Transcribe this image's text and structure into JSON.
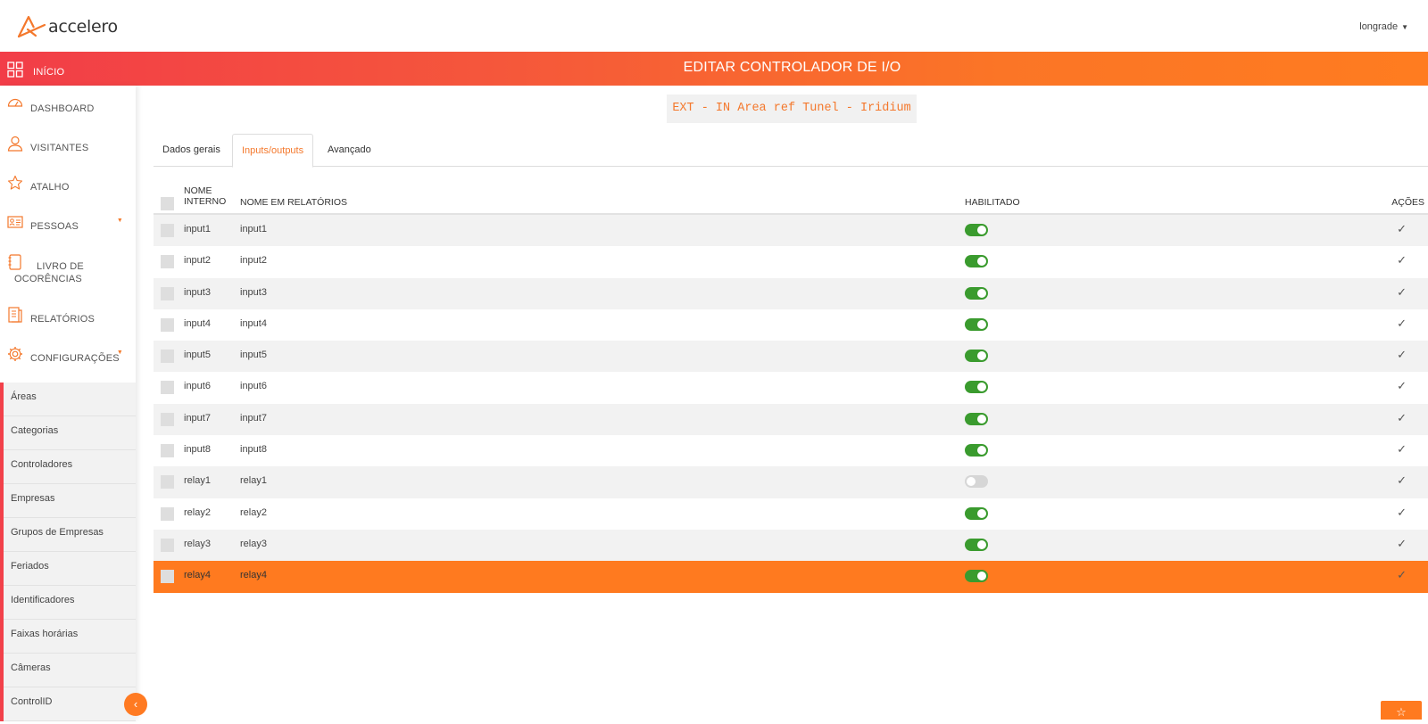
{
  "header": {
    "logo_text": "accelero",
    "user": "longrade"
  },
  "titlebar": {
    "home_label": "INÍCIO",
    "page_title": "EDITAR CONTROLADOR DE I/O"
  },
  "sidebar": {
    "items": [
      {
        "label": "DASHBOARD",
        "icon": "dashboard-gauge-icon"
      },
      {
        "label": "VISITANTES",
        "icon": "person-icon"
      },
      {
        "label": "ATALHO",
        "icon": "star-icon"
      },
      {
        "label": "PESSOAS",
        "icon": "id-card-icon"
      },
      {
        "label": "LIVRO DE OCORÊNCIAS",
        "icon": "book-icon"
      },
      {
        "label": "RELATÓRIOS",
        "icon": "report-icon"
      },
      {
        "label": "CONFIGURAÇÕES",
        "icon": "gear-icon"
      }
    ],
    "submenu": [
      "Áreas",
      "Categorias",
      "Controladores",
      "Empresas",
      "Grupos de Empresas",
      "Feriados",
      "Identificadores",
      "Faixas horárias",
      "Câmeras",
      "ControlID"
    ]
  },
  "controller_ref": "EXT - IN Area ref Tunel - Iridium",
  "tabs": [
    {
      "label": "Dados gerais",
      "active": false
    },
    {
      "label": "Inputs/outputs",
      "active": true
    },
    {
      "label": "Avançado",
      "active": false
    }
  ],
  "table": {
    "headers": {
      "internal_line1": "NOME",
      "internal_line2": "INTERNO",
      "report_name": "NOME EM RELATÓRIOS",
      "enabled": "HABILITADO",
      "actions": "AÇÕES"
    },
    "rows": [
      {
        "internal": "input1",
        "report": "input1",
        "enabled": true
      },
      {
        "internal": "input2",
        "report": "input2",
        "enabled": true
      },
      {
        "internal": "input3",
        "report": "input3",
        "enabled": true
      },
      {
        "internal": "input4",
        "report": "input4",
        "enabled": true
      },
      {
        "internal": "input5",
        "report": "input5",
        "enabled": true
      },
      {
        "internal": "input6",
        "report": "input6",
        "enabled": true
      },
      {
        "internal": "input7",
        "report": "input7",
        "enabled": true
      },
      {
        "internal": "input8",
        "report": "input8",
        "enabled": true
      },
      {
        "internal": "relay1",
        "report": "relay1",
        "enabled": false
      },
      {
        "internal": "relay2",
        "report": "relay2",
        "enabled": true
      },
      {
        "internal": "relay3",
        "report": "relay3",
        "enabled": true
      },
      {
        "internal": "relay4",
        "report": "relay4",
        "enabled": true,
        "selected": true
      }
    ],
    "action_glyph": "✓"
  },
  "colors": {
    "accent": "#ff7a1f",
    "gradient_start": "#f23d48",
    "toggle_on": "#3a9b2e"
  }
}
